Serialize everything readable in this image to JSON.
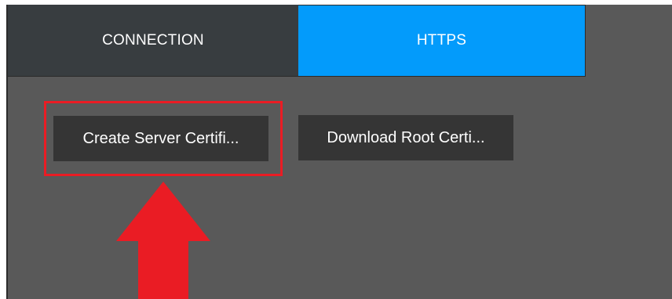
{
  "tabs": [
    {
      "label": "CONNECTION",
      "active": false
    },
    {
      "label": "HTTPS",
      "active": true
    }
  ],
  "buttons": {
    "create_server_certificate": "Create Server Certifi...",
    "download_root_certificate": "Download Root Certi..."
  },
  "colors": {
    "active_tab": "#039bfb",
    "inactive_tab": "#383d40",
    "panel": "#595959",
    "button": "#353535",
    "annotation_red": "#ea1c24"
  }
}
